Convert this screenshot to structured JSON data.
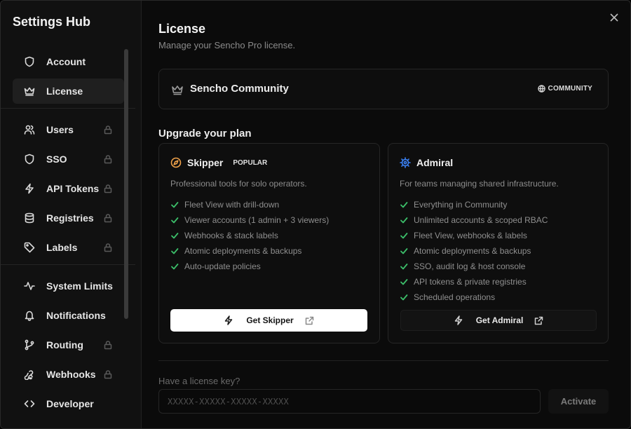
{
  "sidebar": {
    "title": "Settings Hub",
    "items": [
      {
        "label": "Account",
        "icon": "shield-icon",
        "locked": false,
        "active": false
      },
      {
        "label": "License",
        "icon": "crown-icon",
        "locked": false,
        "active": true
      },
      {
        "label": "Users",
        "icon": "users-icon",
        "locked": true,
        "active": false
      },
      {
        "label": "SSO",
        "icon": "shield-icon",
        "locked": true,
        "active": false
      },
      {
        "label": "API Tokens",
        "icon": "bolt-icon",
        "locked": true,
        "active": false
      },
      {
        "label": "Registries",
        "icon": "database-icon",
        "locked": true,
        "active": false
      },
      {
        "label": "Labels",
        "icon": "tag-icon",
        "locked": true,
        "active": false
      },
      {
        "label": "System Limits",
        "icon": "activity-icon",
        "locked": false,
        "active": false
      },
      {
        "label": "Notifications",
        "icon": "bell-icon",
        "locked": false,
        "active": false
      },
      {
        "label": "Routing",
        "icon": "git-branch-icon",
        "locked": true,
        "active": false
      },
      {
        "label": "Webhooks",
        "icon": "webhook-icon",
        "locked": true,
        "active": false
      },
      {
        "label": "Developer",
        "icon": "code-icon",
        "locked": false,
        "active": false
      }
    ]
  },
  "main": {
    "title": "License",
    "subtitle": "Manage your Sencho Pro license.",
    "current_plan": {
      "name": "Sencho Community",
      "badge": "COMMUNITY"
    },
    "upgrade_title": "Upgrade your plan",
    "plans": [
      {
        "name": "Skipper",
        "badge": "POPULAR",
        "icon": "compass-icon",
        "icon_color": "#f0a24a",
        "description": "Professional tools for solo operators.",
        "features": [
          "Fleet View with drill-down",
          "Viewer accounts (1 admin + 3 viewers)",
          "Webhooks & stack labels",
          "Atomic deployments & backups",
          "Auto-update policies"
        ],
        "button_label": "Get Skipper"
      },
      {
        "name": "Admiral",
        "badge": "",
        "icon": "helm-icon",
        "icon_color": "#3b82f6",
        "description": "For teams managing shared infrastructure.",
        "features": [
          "Everything in Community",
          "Unlimited accounts & scoped RBAC",
          "Fleet View, webhooks & labels",
          "Atomic deployments & backups",
          "SSO, audit log & host console",
          "API tokens & private registries",
          "Scheduled operations"
        ],
        "button_label": "Get Admiral"
      }
    ],
    "license_key": {
      "label": "Have a license key?",
      "placeholder": "XXXXX-XXXXX-XXXXX-XXXXX",
      "value": "",
      "button_label": "Activate"
    }
  },
  "colors": {
    "check": "#3cbf6a",
    "background": "#0b0b0b",
    "sidebar": "#111111"
  }
}
